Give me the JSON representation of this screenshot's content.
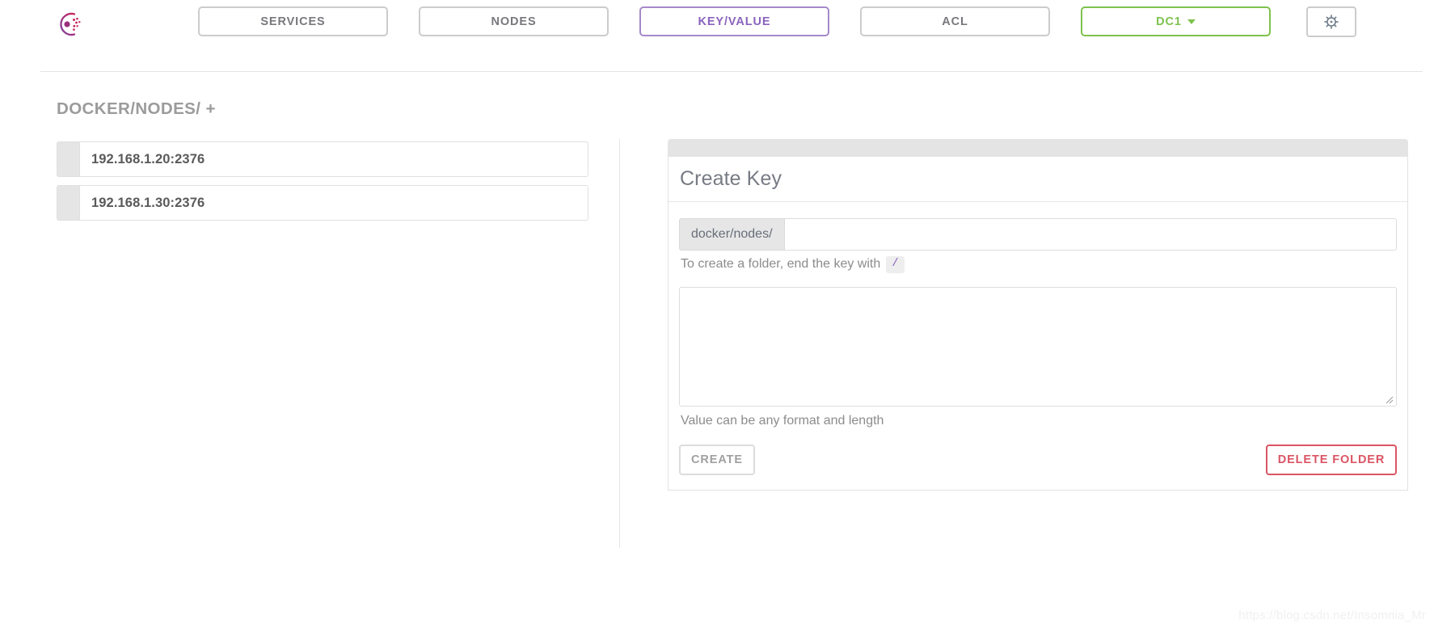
{
  "nav": {
    "logo": "consul-logo",
    "items": [
      {
        "id": "services",
        "label": "SERVICES",
        "active": false
      },
      {
        "id": "nodes",
        "label": "NODES",
        "active": false
      },
      {
        "id": "keyvalue",
        "label": "KEY/VALUE",
        "active": true
      },
      {
        "id": "acl",
        "label": "ACL",
        "active": false
      }
    ],
    "datacenter": {
      "label": "DC1",
      "has_caret": true
    },
    "settings_icon": "gear-icon",
    "colors": {
      "active_purple": "#8a63be",
      "datacenter_green": "#7ec24e",
      "default_border": "#cccccc",
      "danger_red": "#db5565"
    }
  },
  "breadcrumb": {
    "path": "DOCKER/NODES/",
    "add": "+"
  },
  "key_list": {
    "items": [
      {
        "label": "192.168.1.20:2376"
      },
      {
        "label": "192.168.1.30:2376"
      }
    ]
  },
  "panel": {
    "title": "Create Key",
    "key_input": {
      "prefix": "docker/nodes/",
      "value": "",
      "placeholder": ""
    },
    "key_help_before": "To create a folder, end the key with",
    "key_help_code": "/",
    "value_textarea": {
      "value": "",
      "placeholder": ""
    },
    "value_help": "Value can be any format and length",
    "create_button": "CREATE",
    "delete_button": "DELETE FOLDER"
  },
  "watermark": "https://blog.csdn.net/Insomnia_Mr"
}
